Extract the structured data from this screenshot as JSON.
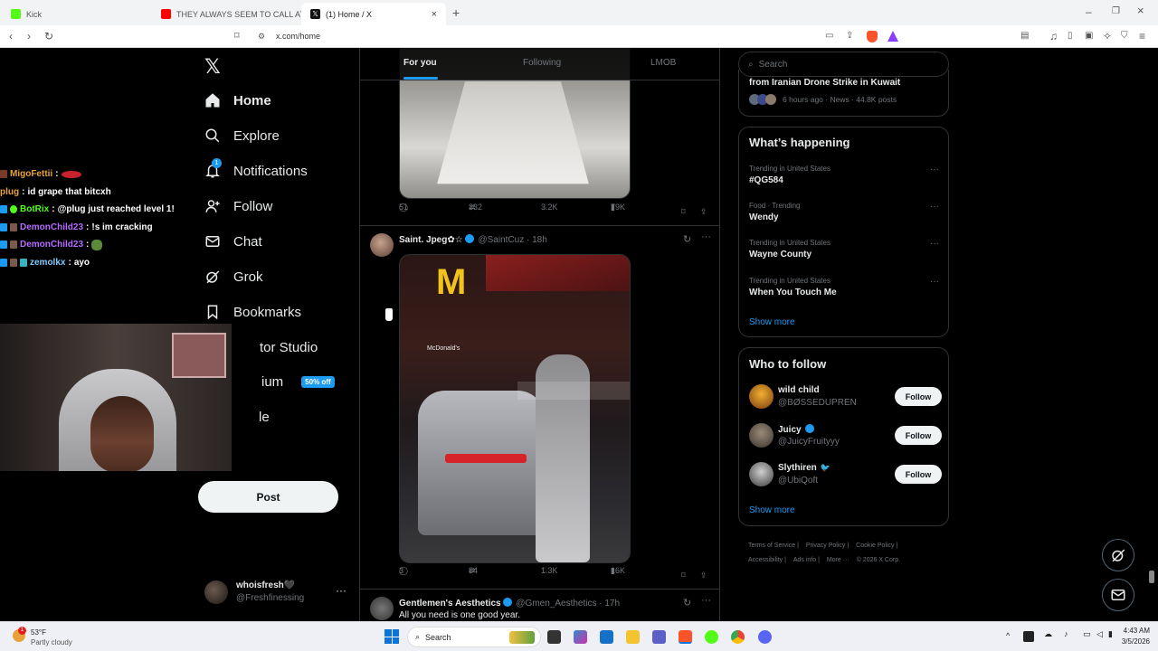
{
  "browser": {
    "tabs": [
      {
        "title": "Kick",
        "color": "#53fc18"
      },
      {
        "title": "THEY ALWAYS SEEM TO CALL AT THE",
        "color": "#ff0000"
      },
      {
        "title": "(1) Home / X",
        "color": "#111111",
        "active": true
      }
    ],
    "url": "x.com/home"
  },
  "nav": {
    "items": [
      {
        "label": "Home",
        "icon": "home-icon",
        "bold": true
      },
      {
        "label": "Explore",
        "icon": "search-icon"
      },
      {
        "label": "Notifications",
        "icon": "bell-icon",
        "badge": "1"
      },
      {
        "label": "Follow",
        "icon": "person-plus-icon"
      },
      {
        "label": "Chat",
        "icon": "envelope-icon"
      },
      {
        "label": "Grok",
        "icon": "grok-icon"
      },
      {
        "label": "Bookmarks",
        "icon": "bookmark-icon"
      },
      {
        "label": "tor Studio",
        "icon": "none"
      },
      {
        "label": "ium",
        "icon": "none",
        "pill": "50% off"
      },
      {
        "label": "le",
        "icon": "none"
      }
    ],
    "post_label": "Post",
    "account": {
      "name": "whoisfresh🖤",
      "handle": "@Freshfinessing"
    }
  },
  "feed": {
    "tabs": [
      "For you",
      "Following",
      "LMOB"
    ],
    "tweet1_actions": {
      "replies": "51",
      "reposts": "332",
      "likes": "3.2K",
      "views": "79K"
    },
    "tweet2": {
      "name": "Saint. Jpeg✿☆",
      "handle": "@SaintCuz",
      "time": "18h",
      "sign": "McDonald's",
      "actions": {
        "replies": "3",
        "reposts": "84",
        "likes": "1.3K",
        "views": "16K"
      }
    },
    "tweet3": {
      "name": "Gentlemen's Aesthetics",
      "handle": "@Gmen_Aesthetics",
      "time": "17h",
      "text": "All you need is one good year."
    }
  },
  "right": {
    "search_placeholder": "Search",
    "top_story": {
      "title": "from Iranian Drone Strike in Kuwait",
      "meta": "6 hours ago · News · 44.8K posts"
    },
    "happening_title": "What’s happening",
    "trends": [
      {
        "category": "Trending in United States",
        "name": "#QG584"
      },
      {
        "category": "Food · Trending",
        "name": "Wendy"
      },
      {
        "category": "Trending in United States",
        "name": "Wayne County"
      },
      {
        "category": "Trending in United States",
        "name": "When You Touch Me"
      }
    ],
    "show_more": "Show more",
    "wtf_title": "Who to follow",
    "who_to_follow": [
      {
        "name": "wild child",
        "handle": "@BØSSEDUPREN",
        "verified": false
      },
      {
        "name": "Juicy",
        "handle": "@JuicyFruityyy",
        "verified": true
      },
      {
        "name": "Slythiren",
        "handle": "@UbiQoft",
        "verified": false
      }
    ],
    "follow_label": "Follow",
    "footer": {
      "links": [
        "Terms of Service",
        "Privacy Policy",
        "Cookie Policy",
        "Accessibility",
        "Ads info",
        "More ···"
      ],
      "copyright": "© 2026 X Corp."
    }
  },
  "stream_chat": [
    {
      "user": "MigoFettii",
      "msg": "",
      "color": "#e9a23b"
    },
    {
      "user": "plug",
      "msg": "id grape that bitcxh",
      "color": "#e9a23b"
    },
    {
      "user": "BotRix",
      "msg": "@plug just reached level 1!",
      "color": "#53fc18"
    },
    {
      "user": "DemonChild23",
      "msg": "!s im cracking",
      "color": "#b56cff"
    },
    {
      "user": "DemonChild23",
      "msg": "",
      "color": "#b56cff"
    },
    {
      "user": "zemolkx",
      "msg": "ayo",
      "color": "#7ecbff"
    }
  ],
  "taskbar": {
    "weather_temp": "53°F",
    "weather_desc": "Partly cloudy",
    "search_label": "Search",
    "time": "4:43 AM",
    "date": "3/5/2026"
  }
}
